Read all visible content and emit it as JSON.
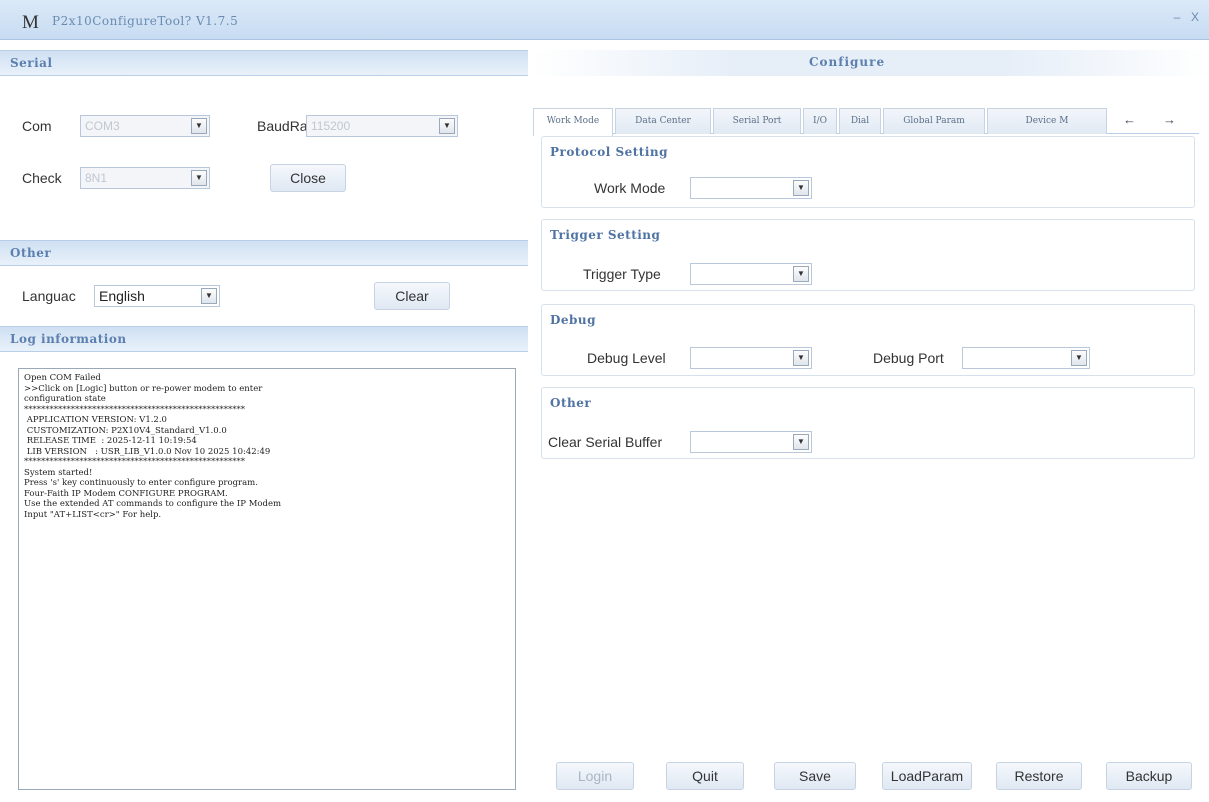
{
  "window": {
    "logo": "M",
    "title": "P2x10ConfigureTool? V1.7.5",
    "minimize": "–",
    "close": "X"
  },
  "serial": {
    "title": "Serial",
    "com_label": "Com",
    "com_value": "COM3",
    "baud_label": "BaudRa",
    "baud_value": "115200",
    "check_label": "Check",
    "check_value": "8N1",
    "close_button": "Close"
  },
  "other": {
    "title": "Other",
    "language_label": "Languac",
    "language_value": "English",
    "clear_button": "Clear"
  },
  "log": {
    "title": "Log information",
    "lines": [
      "Open COM Failed",
      ">>Click on [Logic] button or re-power modem to enter",
      "configuration state",
      "****************************************************",
      " APPLICATION VERSION: V1.2.0",
      " CUSTOMIZATION: P2X10V4_Standard_V1.0.0",
      " RELEASE TIME  : 2025-12-11 10:19:54",
      " LIB VERSION   : USR_LIB_V1.0.0 Nov 10 2025 10:42:49",
      "****************************************************",
      "",
      "System started!",
      "Press 's' key continuously to enter configure program.",
      "Four-Faith IP Modem CONFIGURE PROGRAM.",
      "Use the extended AT commands to configure the IP Modem",
      "Input \"AT+LIST<cr>\" For help."
    ]
  },
  "configure": {
    "title": "Configure",
    "tabs": [
      "Work Mode",
      "Data Center",
      "Serial Port",
      "I/O",
      "Dial",
      "Global Param",
      "Device M"
    ],
    "tab_prev": "←",
    "tab_next": "→",
    "protocol": {
      "title": "Protocol Setting",
      "work_mode_label": "Work Mode"
    },
    "trigger": {
      "title": "Trigger Setting",
      "trigger_type_label": "Trigger Type"
    },
    "debug": {
      "title": "Debug",
      "debug_level_label": "Debug Level",
      "debug_port_label": "Debug Port"
    },
    "other": {
      "title": "Other",
      "clear_serial_label": "Clear Serial Buffer"
    }
  },
  "actions": {
    "login": "Login",
    "quit": "Quit",
    "save": "Save",
    "load_param": "LoadParam",
    "restore": "Restore",
    "backup": "Backup"
  }
}
